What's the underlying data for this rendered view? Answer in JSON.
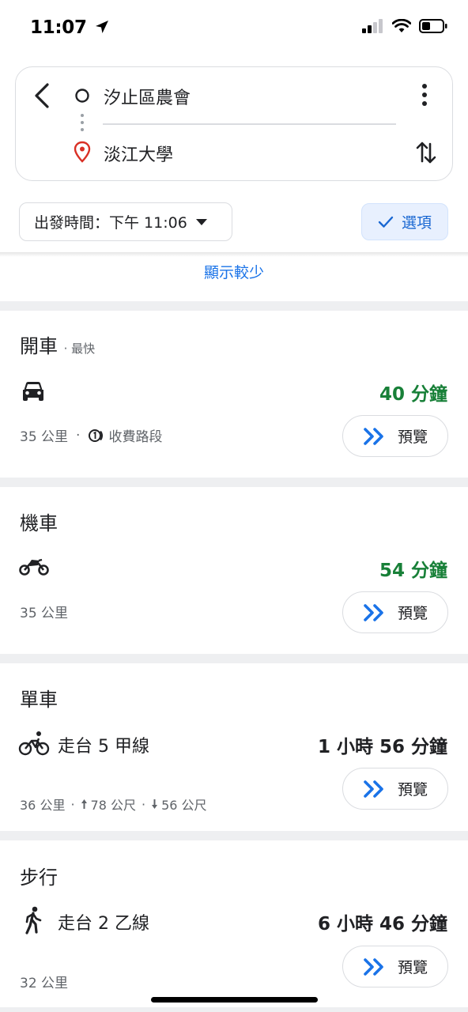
{
  "status_bar": {
    "time": "11:07"
  },
  "search": {
    "origin": "汐止區農會",
    "destination": "淡江大學"
  },
  "departure": {
    "label": "出發時間：下午 11:06"
  },
  "options": {
    "label": "選項"
  },
  "show_less": "顯示較少",
  "modes": {
    "drive": {
      "title": "開車",
      "subtitle": "· 最快",
      "duration": "40 分鐘",
      "distance": "35 公里",
      "separator": "·",
      "toll": "收費路段",
      "preview": "預覽"
    },
    "motorcycle": {
      "title": "機車",
      "duration": "54 分鐘",
      "distance": "35 公里",
      "preview": "預覽"
    },
    "bicycle": {
      "title": "單車",
      "via": "走台 5 甲線",
      "duration": "1 小時 56 分鐘",
      "distance": "36 公里",
      "sep1": "·",
      "ascent": "78 公尺",
      "sep2": "·",
      "descent": "56 公尺",
      "preview": "預覽"
    },
    "walk": {
      "title": "步行",
      "via": "走台 2 乙線",
      "duration": "6 小時 46 分鐘",
      "distance": "32 公里",
      "preview": "預覽"
    }
  },
  "colors": {
    "accent_blue": "#1a73e8",
    "duration_green": "#188038",
    "destination_pin": "#d93025"
  }
}
